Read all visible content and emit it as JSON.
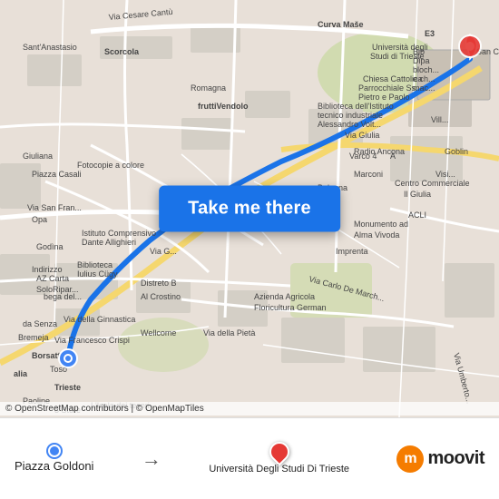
{
  "map": {
    "background_color": "#e8e0d8",
    "attribution": "© OpenStreetMap contributors | © OpenMapTiles",
    "start_location": "Piazza Goldoni",
    "end_location": "Università Degli Studi Di Trieste"
  },
  "button": {
    "label": "Take me there"
  },
  "footer": {
    "from_label": "Piazza Goldoni",
    "to_label": "Università Degli Studi Di Trieste",
    "arrow": "→",
    "moovit_letter": "m",
    "moovit_name": "moovit"
  },
  "colors": {
    "button_bg": "#1a73e8",
    "start_dot": "#4285f4",
    "end_dot": "#e53935",
    "route": "#1a73e8",
    "moovit_orange": "#f57c00"
  }
}
